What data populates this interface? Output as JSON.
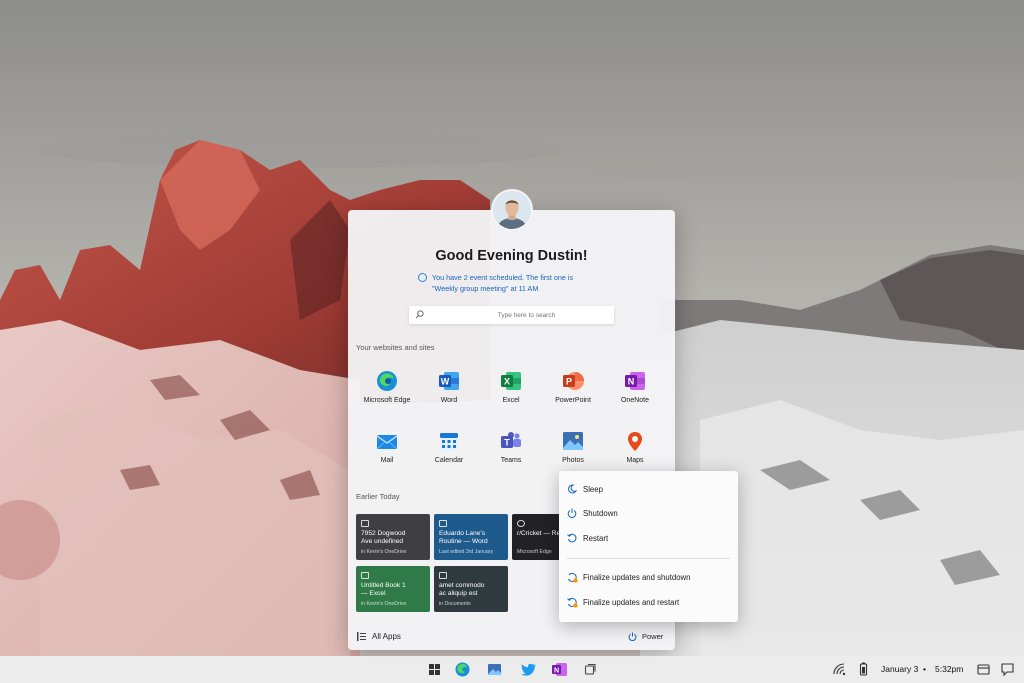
{
  "user": {
    "greeting": "Good Evening Dustin!"
  },
  "event_notice": {
    "line1": "You have 2 event scheduled. The first one is",
    "line2": "\"Weekly group meeting\" at 11 AM"
  },
  "search": {
    "placeholder": "Type here to search"
  },
  "sections": {
    "websites": "Your websites and sites",
    "earlier": "Earlier Today"
  },
  "apps": [
    {
      "label": "Microsoft Edge",
      "icon": "edge-icon",
      "color": "#1a8fd8"
    },
    {
      "label": "Word",
      "icon": "word-icon",
      "color": "#2b5797"
    },
    {
      "label": "Excel",
      "icon": "excel-icon",
      "color": "#217346"
    },
    {
      "label": "PowerPoint",
      "icon": "powerpoint-icon",
      "color": "#d24726"
    },
    {
      "label": "OneNote",
      "icon": "onenote-icon",
      "color": "#7719aa"
    },
    {
      "label": "Mail",
      "icon": "mail-icon",
      "color": "#1e88e5"
    },
    {
      "label": "Calendar",
      "icon": "calendar-icon",
      "color": "#1976d2"
    },
    {
      "label": "Teams",
      "icon": "teams-icon",
      "color": "#5059c9"
    },
    {
      "label": "Photos",
      "icon": "photos-icon",
      "color": "#3b6fb6"
    },
    {
      "label": "Maps",
      "icon": "maps-icon",
      "color": "#e64a19"
    }
  ],
  "recent_docs": [
    {
      "title1": "7952 Dogwood",
      "title2": "Ave undefined",
      "meta": "in Kevin's OneDrive",
      "color": "#3f3f42"
    },
    {
      "title1": "Eduardo Lane's",
      "title2": "Routine — Word",
      "meta": "Last edited 3rd January",
      "color": "#1f5a8c"
    },
    {
      "title1": "r/Cricket — Re",
      "title2": "",
      "meta": "Microsoft Edge",
      "color": "#222226"
    },
    {
      "title1": "Untitled Book 1",
      "title2": "— Excel",
      "meta": "in Kevin's OneDrive",
      "color": "#2f7a46"
    },
    {
      "title1": "amet commodo",
      "title2": "ac aliquip est",
      "meta": "in Documents",
      "color": "#2e3a3e"
    }
  ],
  "footer": {
    "all_apps": "All Apps",
    "power": "Power"
  },
  "power_menu": {
    "sleep": "Sleep",
    "shutdown": "Shutdown",
    "restart": "Restart",
    "update_shutdown": "Finalize updates and shutdown",
    "update_restart": "Finalize updates and restart"
  },
  "taskbar": {
    "date": "January 3",
    "separator": "•",
    "time": "5:32pm"
  }
}
